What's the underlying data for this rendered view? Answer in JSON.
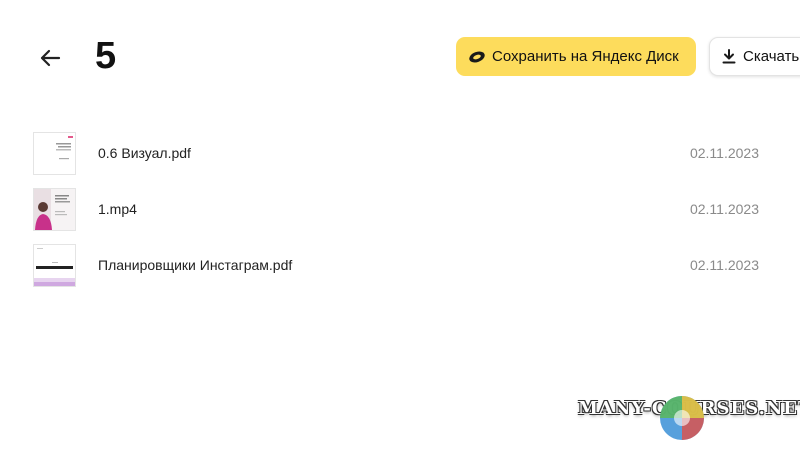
{
  "header": {
    "folder_title": "5",
    "save_label": "Сохранить на Яндекс Диск",
    "download_label": "Скачать"
  },
  "files": [
    {
      "name": "0.6 Визуал.pdf",
      "date": "02.11.2023",
      "thumb": "pdf-doc-thumb"
    },
    {
      "name": "1.mp4",
      "date": "02.11.2023",
      "thumb": "video-thumb"
    },
    {
      "name": "Планировщики Инстаграм.pdf",
      "date": "02.11.2023",
      "thumb": "pdf-planner-thumb"
    }
  ],
  "watermark": {
    "text": "MANY-COURSES.NET"
  },
  "colors": {
    "accent": "#fddc5c",
    "date_text": "#8a8a8a"
  },
  "icons": {
    "back": "arrow-left-icon",
    "save": "yandex-disk-icon",
    "download": "download-icon"
  }
}
